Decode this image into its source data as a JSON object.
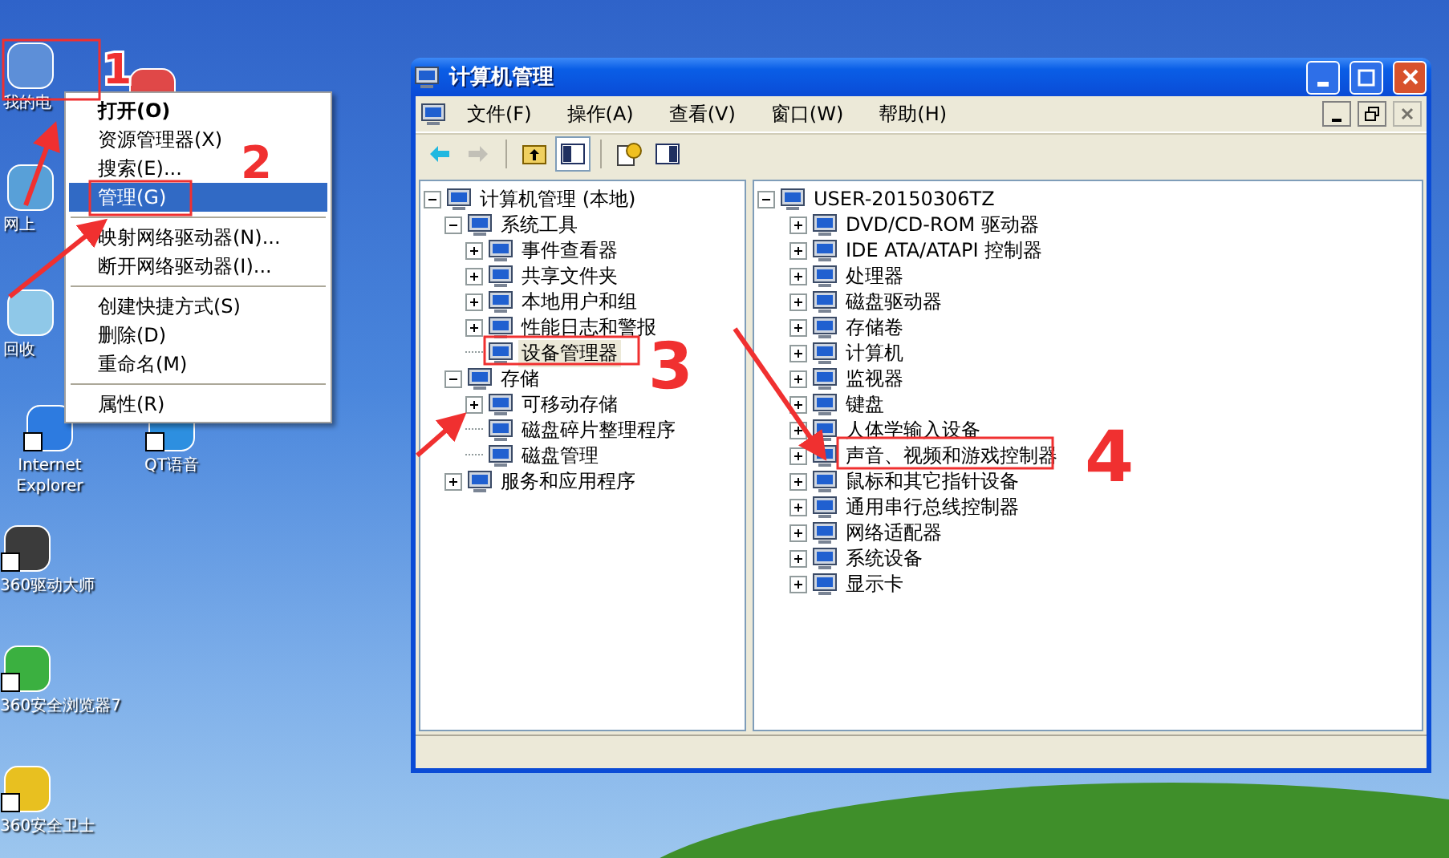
{
  "desktop_icons": [
    {
      "label": "我的电"
    },
    {
      "label": "网上"
    },
    {
      "label": "回收"
    },
    {
      "label": "Internet Explorer"
    },
    {
      "label": "QT语音"
    },
    {
      "label": "360驱动大师"
    },
    {
      "label": "360安全浏览器7"
    },
    {
      "label": "360安全卫士"
    }
  ],
  "context_menu": {
    "groups": [
      [
        {
          "label": "打开(O)",
          "default": true,
          "selected": false
        },
        {
          "label": "资源管理器(X)",
          "default": false,
          "selected": false
        },
        {
          "label": "搜索(E)...",
          "default": false,
          "selected": false
        },
        {
          "label": "管理(G)",
          "default": false,
          "selected": true
        }
      ],
      [
        {
          "label": "映射网络驱动器(N)...",
          "default": false,
          "selected": false
        },
        {
          "label": "断开网络驱动器(I)...",
          "default": false,
          "selected": false
        }
      ],
      [
        {
          "label": "创建快捷方式(S)",
          "default": false,
          "selected": false
        },
        {
          "label": "删除(D)",
          "default": false,
          "selected": false
        },
        {
          "label": "重命名(M)",
          "default": false,
          "selected": false
        }
      ],
      [
        {
          "label": "属性(R)",
          "default": false,
          "selected": false
        }
      ]
    ]
  },
  "window": {
    "title": "计算机管理",
    "menu": [
      "文件(F)",
      "操作(A)",
      "查看(V)",
      "窗口(W)",
      "帮助(H)"
    ],
    "toolbar": [
      {
        "kind": "back",
        "disabled": false,
        "pressed": false
      },
      {
        "kind": "forward",
        "disabled": true,
        "pressed": false
      },
      {
        "kind": "up",
        "disabled": false,
        "pressed": false
      },
      {
        "kind": "tree",
        "disabled": false,
        "pressed": true
      },
      {
        "kind": "help",
        "disabled": false,
        "pressed": false
      },
      {
        "kind": "panel",
        "disabled": false,
        "pressed": false
      }
    ],
    "left_tree": [
      {
        "label": "计算机管理 (本地)",
        "expanded": true,
        "selected": false,
        "children": [
          {
            "label": "系统工具",
            "expanded": true,
            "selected": false,
            "children": [
              {
                "label": "事件查看器",
                "expanded": false,
                "selected": false,
                "leaf": false
              },
              {
                "label": "共享文件夹",
                "expanded": false,
                "selected": false,
                "leaf": false
              },
              {
                "label": "本地用户和组",
                "expanded": false,
                "selected": false,
                "leaf": false
              },
              {
                "label": "性能日志和警报",
                "expanded": false,
                "selected": false,
                "leaf": false
              },
              {
                "label": "设备管理器",
                "selected": true,
                "leaf": true
              }
            ]
          },
          {
            "label": "存储",
            "expanded": true,
            "selected": false,
            "children": [
              {
                "label": "可移动存储",
                "expanded": false,
                "selected": false,
                "leaf": false
              },
              {
                "label": "磁盘碎片整理程序",
                "selected": false,
                "leaf": true
              },
              {
                "label": "磁盘管理",
                "selected": false,
                "leaf": true
              }
            ]
          },
          {
            "label": "服务和应用程序",
            "expanded": false,
            "selected": false,
            "leaf": false
          }
        ]
      }
    ],
    "right_tree": [
      {
        "label": "USER-20150306TZ",
        "expanded": true,
        "selected": false,
        "children": [
          {
            "label": "DVD/CD-ROM 驱动器",
            "expanded": false,
            "selected": false
          },
          {
            "label": "IDE ATA/ATAPI 控制器",
            "expanded": false,
            "selected": false
          },
          {
            "label": "处理器",
            "expanded": false,
            "selected": false
          },
          {
            "label": "磁盘驱动器",
            "expanded": false,
            "selected": false
          },
          {
            "label": "存储卷",
            "expanded": false,
            "selected": false
          },
          {
            "label": "计算机",
            "expanded": false,
            "selected": false
          },
          {
            "label": "监视器",
            "expanded": false,
            "selected": false
          },
          {
            "label": "键盘",
            "expanded": false,
            "selected": false
          },
          {
            "label": "人体学输入设备",
            "expanded": false,
            "selected": false
          },
          {
            "label": "声音、视频和游戏控制器",
            "expanded": false,
            "selected": false
          },
          {
            "label": "鼠标和其它指针设备",
            "expanded": false,
            "selected": false
          },
          {
            "label": "通用串行总线控制器",
            "expanded": false,
            "selected": false
          },
          {
            "label": "网络适配器",
            "expanded": false,
            "selected": false
          },
          {
            "label": "系统设备",
            "expanded": false,
            "selected": false
          },
          {
            "label": "显示卡",
            "expanded": false,
            "selected": false
          }
        ]
      }
    ]
  },
  "annotations": [
    {
      "label": "1"
    },
    {
      "label": "2"
    },
    {
      "label": "3"
    },
    {
      "label": "4"
    }
  ]
}
